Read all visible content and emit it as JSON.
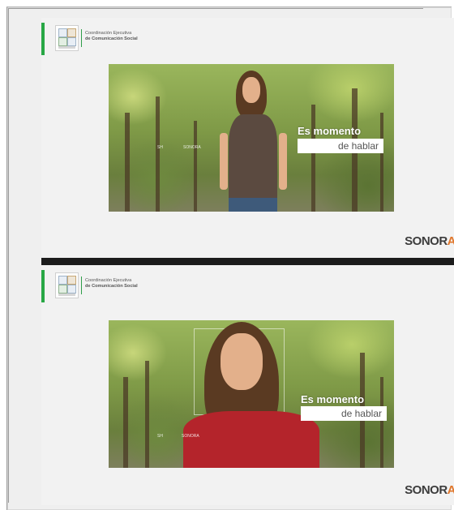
{
  "org": {
    "line1": "Coordinación Ejecutiva",
    "line2": "de Comunicación Social"
  },
  "campaign": {
    "title": "Es momento",
    "subtitle": "de hablar",
    "watermark1": "SH",
    "watermark2": "SONORA"
  },
  "brand": {
    "prefix": "SONOR",
    "accent_letter": "A",
    "accent_color": "#e0762a"
  },
  "colors": {
    "green": "#28a745",
    "divider": "#1c1c1c"
  }
}
